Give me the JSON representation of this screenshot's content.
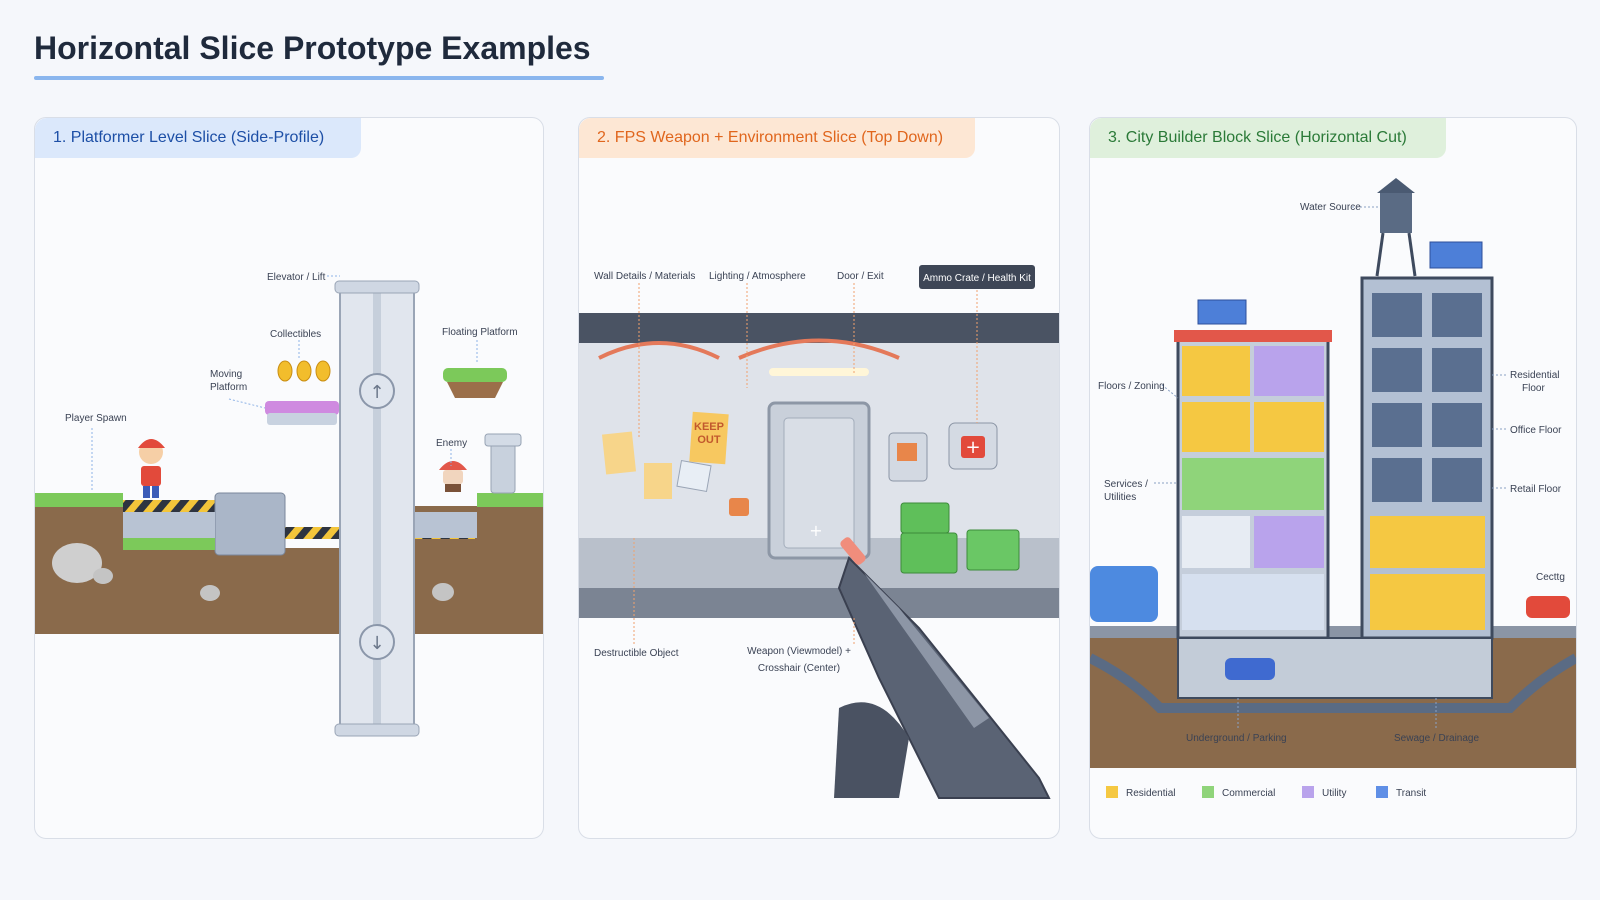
{
  "page": {
    "title": "Horizontal Slice Prototype Examples"
  },
  "panels": {
    "platformer": {
      "title": "1.  Platformer Level Slice (Side-Profile)",
      "labels": {
        "elevator": "Elevator / Lift",
        "collectibles": "Collectibles",
        "floating_platform": "Floating Platform",
        "moving_platform_1": "Moving",
        "moving_platform_2": "Platform",
        "player_spawn": "Player Spawn",
        "enemy": "Enemy"
      }
    },
    "fps": {
      "title": "2.  FPS Weapon + Environment Slice (Top Down)",
      "labels": {
        "wall_details": "Wall Details / Materials",
        "lighting": "Lighting / Atmosphere",
        "door": "Door / Exit",
        "ammo": "Ammo Crate / Health Kit",
        "destructible": "Destructible Object",
        "weapon_1": "Weapon (Viewmodel) +",
        "weapon_2": "Crosshair (Center)",
        "poster_1": "KEEP",
        "poster_2": "OUT"
      }
    },
    "city": {
      "title": "3.  City Builder Block Slice (Horizontal Cut)",
      "labels": {
        "water": "Water Source",
        "floors": "Floors / Zoning",
        "residential_1": "Residential",
        "residential_2": "Floor",
        "office": "Office Floor",
        "retail": "Retail Floor",
        "services_1": "Services /",
        "services_2": "Utilities",
        "underground": "Underground / Parking",
        "sewage": "Sewage / Drainage",
        "sign": "Cecttg"
      },
      "legend": [
        {
          "label": "Residential",
          "color": "#f5c842"
        },
        {
          "label": "Commercial",
          "color": "#8fd47a"
        },
        {
          "label": "Utility",
          "color": "#b9a3ec"
        },
        {
          "label": "Transit",
          "color": "#5f8fe6"
        }
      ]
    }
  }
}
